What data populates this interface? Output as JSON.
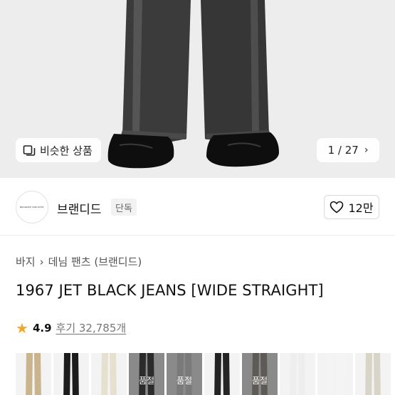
{
  "hero": {
    "similar_label": "비슷한 상품",
    "pager": "1 / 27",
    "colors": {
      "bg": "#ededed",
      "denim": "#3a3a3a",
      "shoe": "#0d0d0d"
    }
  },
  "brand": {
    "name": "브랜디드",
    "badge": "단독",
    "logo_text": "BRANDED INDUSTRY",
    "likes": "12만"
  },
  "breadcrumb": [
    "바지",
    "데님 팬츠 (브랜디드)"
  ],
  "product": {
    "title": "1967 JET BLACK JEANS [WIDE STRAIGHT]",
    "rating": "4.9",
    "reviews": "후기 32,785개"
  },
  "options": [
    {
      "color": "#c9b48e",
      "bg": "#f3f3f3",
      "soldout": ""
    },
    {
      "color": "#1c1c1c",
      "bg": "#f3f3f3",
      "soldout": ""
    },
    {
      "color": "#e6e0d0",
      "bg": "#f3f3f3",
      "soldout": ""
    },
    {
      "color": "#2b2b2b",
      "bg": "#8a8a8a",
      "soldout": "품절"
    },
    {
      "color": "#7a7a7a",
      "bg": "#8a8a8a",
      "soldout": "품절"
    },
    {
      "color": "#242424",
      "bg": "#f3f3f3",
      "soldout": ""
    },
    {
      "color": "#5e5a55",
      "bg": "#8a8a8a",
      "soldout": "품절"
    },
    {
      "color": "#eeeeee",
      "bg": "#f3f3f3",
      "soldout": ""
    },
    {
      "color": "#f4f4f4",
      "bg": "#f3f3f3",
      "soldout": ""
    },
    {
      "color": "#d9d4c8",
      "bg": "#f3f3f3",
      "soldout": ""
    }
  ]
}
